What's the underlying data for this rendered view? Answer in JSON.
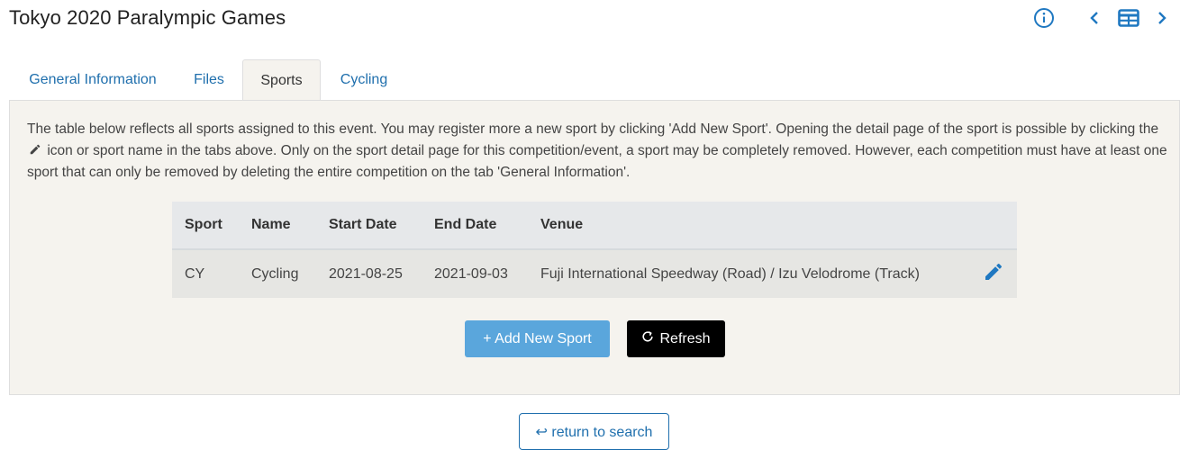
{
  "page": {
    "title": "Tokyo 2020 Paralympic Games"
  },
  "header_icons": [
    {
      "name": "info-icon"
    },
    {
      "name": "chevron-left-icon"
    },
    {
      "name": "table-grid-icon"
    },
    {
      "name": "chevron-right-icon"
    }
  ],
  "tabs": [
    {
      "label": "General Information",
      "active": false
    },
    {
      "label": "Files",
      "active": false
    },
    {
      "label": "Sports",
      "active": true
    },
    {
      "label": "Cycling",
      "active": false
    }
  ],
  "description": {
    "part1": "The table below reflects all sports assigned to this event. You may register more a new sport by clicking 'Add New Sport'. Opening the detail page of the sport is possible by clicking the",
    "part2": "icon or sport name in the tabs above. Only on the sport detail page for this competition/event, a sport may be completely removed. However, each competition must have at least one sport that can only be removed by deleting the entire competition on the tab 'General Information'."
  },
  "table": {
    "columns": [
      "Sport",
      "Name",
      "Start Date",
      "End Date",
      "Venue"
    ],
    "rows": [
      {
        "sport": "CY",
        "name": "Cycling",
        "start_date": "2021-08-25",
        "end_date": "2021-09-03",
        "venue": "Fuji International Speedway (Road) / Izu Velodrome (Track)"
      }
    ]
  },
  "buttons": {
    "add_new_sport": "+ Add New Sport",
    "refresh": "Refresh",
    "return_to_search": "↩ return to search"
  },
  "colors": {
    "accent": "#1f78c1",
    "add_button": "#5aa6dc",
    "refresh_button": "#000000",
    "panel_background": "#f5f3ee"
  }
}
